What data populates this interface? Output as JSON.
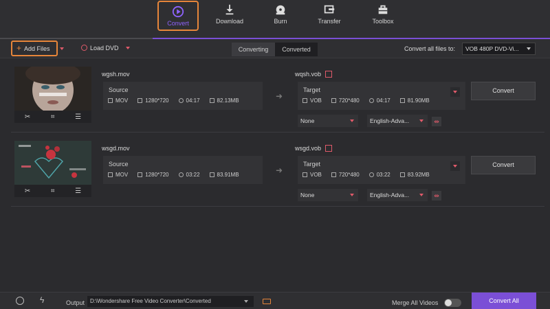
{
  "nav": {
    "tabs": [
      {
        "label": "Convert",
        "icon": "convert-icon"
      },
      {
        "label": "Download",
        "icon": "download-icon"
      },
      {
        "label": "Burn",
        "icon": "burn-icon"
      },
      {
        "label": "Transfer",
        "icon": "transfer-icon"
      },
      {
        "label": "Toolbox",
        "icon": "toolbox-icon"
      }
    ],
    "accent": "#7b4fd6"
  },
  "toolbar": {
    "add_files": "Add Files",
    "load_dvd": "Load DVD",
    "seg_converting": "Converting",
    "seg_converted": "Converted",
    "convert_all_label": "Convert all files to:",
    "format_value": "VOB 480P DVD-Vi..."
  },
  "files": [
    {
      "source_name": "wgsh.mov",
      "source_label": "Source",
      "source_format": "MOV",
      "source_res": "1280*720",
      "source_duration": "04:17",
      "source_size": "82.13MB",
      "target_name": "wqsh.vob",
      "target_label": "Target",
      "target_format": "VOB",
      "target_res": "720*480",
      "target_duration": "04:17",
      "target_size": "81.90MB",
      "subtitle": "None",
      "audio": "English-Adva...",
      "convert": "Convert"
    },
    {
      "source_name": "wsgd.mov",
      "source_label": "Source",
      "source_format": "MOV",
      "source_res": "1280*720",
      "source_duration": "03:22",
      "source_size": "83.91MB",
      "target_name": "wsgd.vob",
      "target_label": "Target",
      "target_format": "VOB",
      "target_res": "720*480",
      "target_duration": "03:22",
      "target_size": "83.92MB",
      "subtitle": "None",
      "audio": "English-Adva...",
      "convert": "Convert"
    }
  ],
  "bottom": {
    "output_label": "Output",
    "output_path": "D:\\Wondershare Free Video Converter\\Converted",
    "merge_label": "Merge All Videos",
    "convert_all": "Convert All"
  }
}
